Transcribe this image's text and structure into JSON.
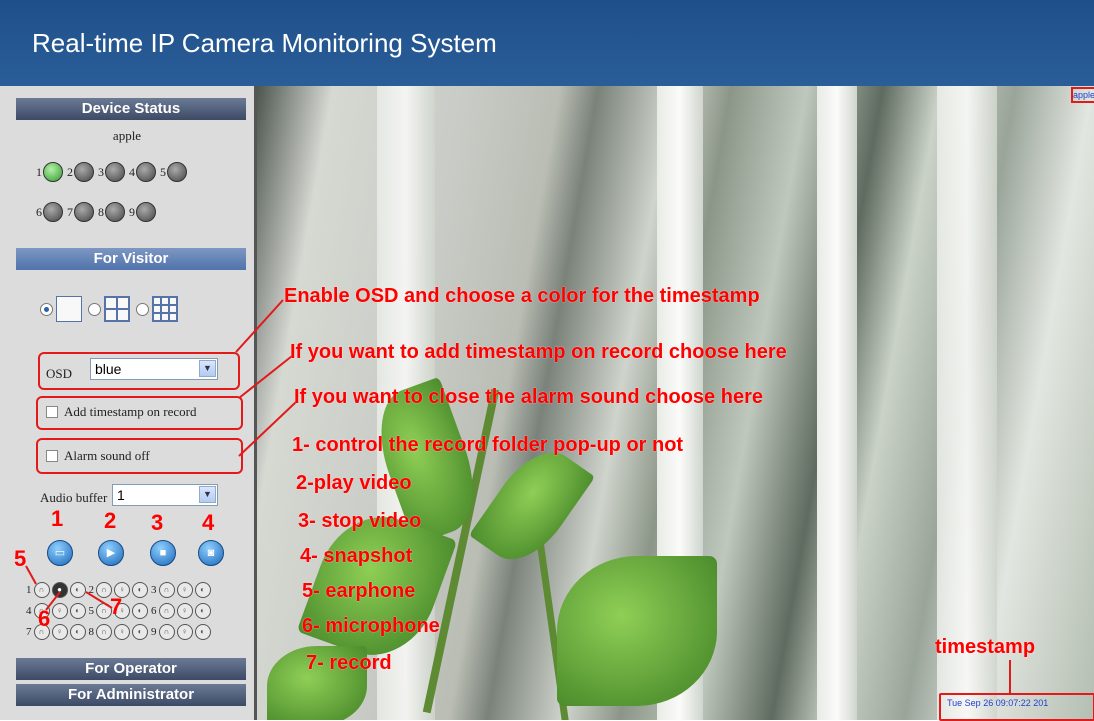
{
  "header": {
    "title": "Real-time IP Camera Monitoring System"
  },
  "sidebar": {
    "device_status_title": "Device Status",
    "device_name": "apple",
    "lamps_row1": [
      "1",
      "2",
      "3",
      "4",
      "5"
    ],
    "lamps_row2": [
      "6",
      "7",
      "8",
      "9"
    ],
    "for_visitor_title": "For Visitor",
    "osd_label": "OSD",
    "osd_value": "blue",
    "timestamp_label": "Add timestamp on record",
    "alarm_label": "Alarm sound off",
    "audio_buffer_label": "Audio buffer",
    "audio_buffer_value": "1",
    "channel_numbers": [
      "1",
      "2",
      "3",
      "4",
      "5",
      "6",
      "7",
      "8",
      "9"
    ],
    "for_operator_title": "For Operator",
    "for_administrator_title": "For Administrator"
  },
  "annotations": {
    "osd": "Enable OSD and choose a color for the timestamp",
    "timestamp": "If you want to add timestamp on record choose here",
    "alarm": "If you want to close the alarm sound choose here",
    "item1": "1- control the record folder pop-up or not",
    "item2": "2-play video",
    "item3": "3- stop video",
    "item4": "4- snapshot",
    "item5": "5- earphone",
    "item6": "6- microphone",
    "item7": "7- record",
    "timestamp_label": "timestamp",
    "n1": "1",
    "n2": "2",
    "n3": "3",
    "n4": "4",
    "n5": "5",
    "n6": "6",
    "n7": "7"
  },
  "video": {
    "timestamp_text": "Tue Sep 26 09:07:22 201",
    "device_tag": "apple"
  },
  "colors": {
    "accent_red": "#ff0000",
    "header_blue": "#2a5e98"
  }
}
